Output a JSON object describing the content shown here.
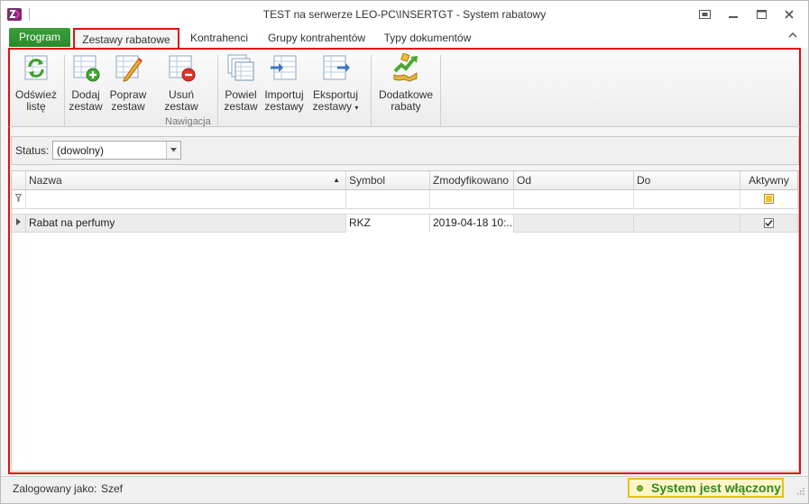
{
  "window": {
    "title": "TEST na serwerze LEO-PC\\INSERTGT - System rabatowy"
  },
  "ribbon_tabs": {
    "program": "Program",
    "items": [
      "Zestawy rabatowe",
      "Kontrahenci",
      "Grupy kontrahentów",
      "Typy dokumentów"
    ],
    "active": "Zestawy rabatowe"
  },
  "ribbon": {
    "buttons": [
      {
        "line1": "Odśwież",
        "line2": "listę",
        "icon": "refresh-icon"
      },
      {
        "line1": "Dodaj",
        "line2": "zestaw",
        "icon": "add-set-icon"
      },
      {
        "line1": "Popraw",
        "line2": "zestaw",
        "icon": "edit-set-icon"
      },
      {
        "line1": "Usuń zestaw",
        "line2": "",
        "icon": "delete-set-icon"
      },
      {
        "line1": "Powiel",
        "line2": "zestaw",
        "icon": "duplicate-set-icon"
      },
      {
        "line1": "Importuj",
        "line2": "zestawy",
        "icon": "import-icon"
      },
      {
        "line1": "Eksportuj",
        "line2": "zestawy",
        "icon": "export-icon"
      },
      {
        "line1": "Dodatkowe",
        "line2": "rabaty",
        "icon": "extra-discounts-icon"
      }
    ],
    "group_label": "Nawigacja",
    "export_arrow": "▾"
  },
  "filter": {
    "label": "Status:",
    "value": "(dowolny)"
  },
  "grid": {
    "columns": [
      "Nazwa",
      "Symbol",
      "Zmodyfikowano",
      "Od",
      "Do",
      "Aktywny"
    ],
    "sorted_column": "Nazwa",
    "sort_direction": "ascending",
    "rows": [
      {
        "nazwa": "Rabat na perfumy",
        "symbol": "RKZ",
        "zmodyfikowano": "2019-04-18 10:...",
        "od": "",
        "do": "",
        "aktywny": true
      }
    ]
  },
  "status_bar": {
    "label": "Zalogowany jako:",
    "user": "Szef",
    "system_status": "System jest włączony"
  },
  "colors": {
    "highlight_frame": "#dd1111",
    "program_tab": "#2f9a2f",
    "status_text": "#2f8a1c",
    "status_pill_bg": "#fff6c8"
  }
}
